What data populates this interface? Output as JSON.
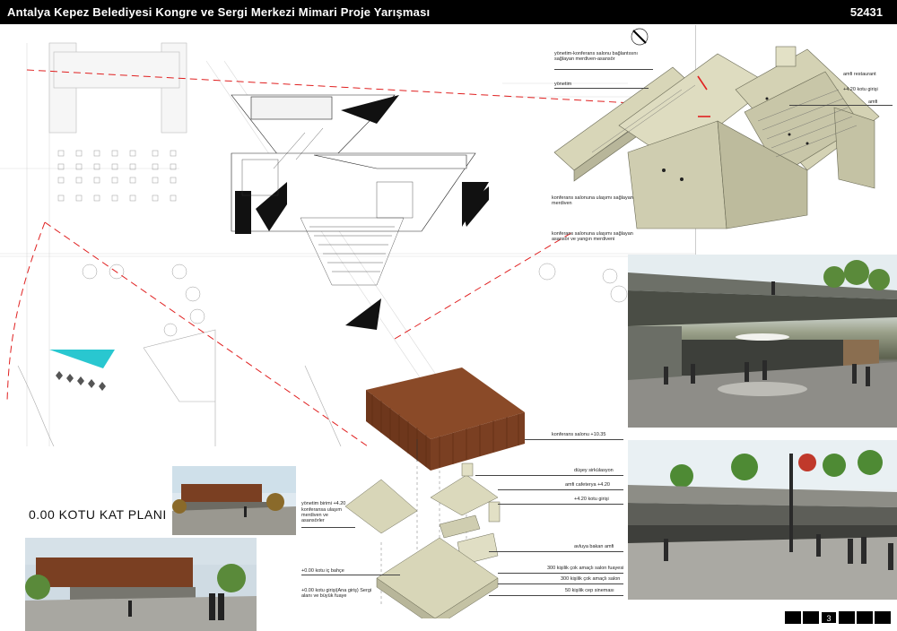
{
  "header": {
    "title": "Antalya Kepez Belediyesi Kongre ve Sergi Merkezi Mimari Proje Yarışması",
    "code": "52431"
  },
  "plan": {
    "label": "0.00 KOTU KAT PLANI"
  },
  "axo_top": {
    "labels": [
      "yönetim-konferans salonu bağlantısını sağlayan merdiven-asansör",
      "yönetim",
      "amfi restaurant",
      "+4.20 kotu girişi",
      "amfi",
      "konferans salonuna ulaşımı sağlayan merdiven",
      "konferans salonuna ulaşımı sağlayan asansör ve yangın merdiveni"
    ]
  },
  "exploded": {
    "labels_right": [
      "konferans salonu +10.35",
      "düşey sirkülasyon",
      "amfi cafeterya +4.20",
      "+4.20 kotu girişi",
      "avluya bakan amfi",
      "300 kişilik çok amaçlı salon fuayesi",
      "300 kişilik çok amaçlı salon",
      "50 kişilik cep sineması"
    ],
    "labels_left": [
      "yönetim birimi +4.20",
      "konferansa ulaşım merdiven ve asansörler",
      "+0.00 kotu iç bahçe",
      "+0.00 kotu girişi(Ana giriş) Sergi alanı ve büyük fuaye"
    ]
  },
  "pager": {
    "pages": [
      "",
      "",
      "3",
      "",
      "",
      ""
    ],
    "current": "3"
  },
  "colors": {
    "header_bg": "#000000",
    "wood": "#7a3f22",
    "model": "#d8d6b8",
    "section_red": "#e02020",
    "terrace_cyan": "#29c7d0"
  }
}
